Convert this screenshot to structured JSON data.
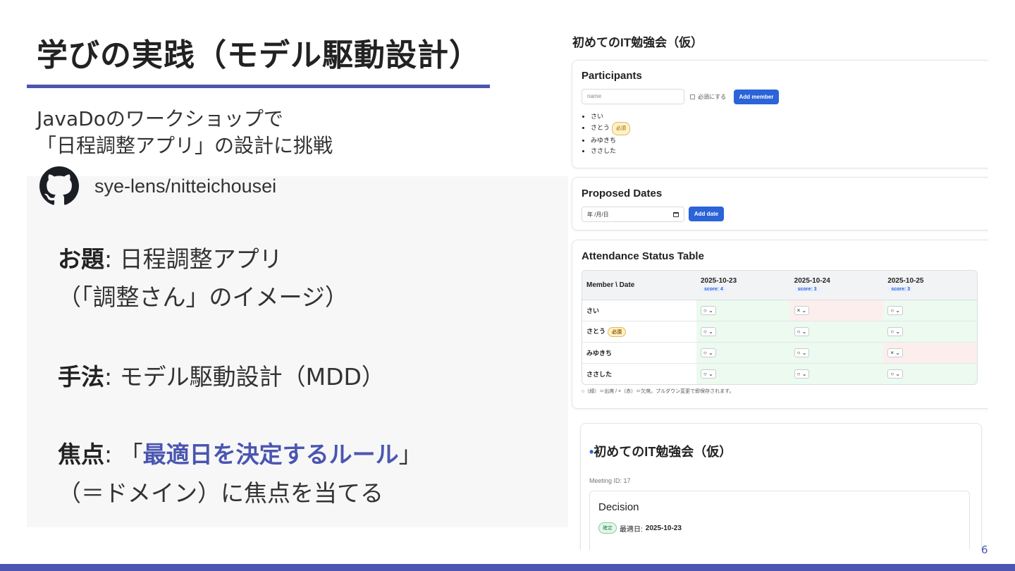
{
  "slide": {
    "title": "学びの実践（モデル駆動設計）",
    "intro_line1": "JavaDoのワークショップで",
    "intro_line2": "「日程調整アプリ」の設計に挑戦",
    "github_repo": "sye-lens/nitteichousei",
    "points": {
      "theme_label": "お題",
      "theme_value": ": 日程調整アプリ",
      "theme_note": "（「調整さん」のイメージ）",
      "method_label": "手法",
      "method_value": ": モデル駆動設計（MDD）",
      "focus_label": "焦点",
      "focus_pre": ": 「",
      "focus_highlight": "最適日を決定するルール",
      "focus_post": "」",
      "focus_note": "（＝ドメイン）に焦点を当てる"
    },
    "page_number": "6",
    "accent_color": "#4a56b0"
  },
  "app": {
    "title": "初めてのIT勉強会（仮）",
    "participants": {
      "heading": "Participants",
      "name_placeholder": "name",
      "required_checkbox_label": "必須にする",
      "add_button": "Add member",
      "members": [
        {
          "name": "さい",
          "required": false
        },
        {
          "name": "さとう",
          "required": true
        },
        {
          "name": "みゆきち",
          "required": false
        },
        {
          "name": "ささした",
          "required": false
        }
      ],
      "required_badge": "必須"
    },
    "proposed_dates": {
      "heading": "Proposed Dates",
      "date_placeholder": "年 /月/日",
      "calendar_icon": "calendar-icon",
      "add_button": "Add date"
    },
    "attendance": {
      "heading": "Attendance Status Table",
      "corner_header": "Member \\ Date",
      "dates": [
        {
          "date": "2025-10-23",
          "score": "score: 4"
        },
        {
          "date": "2025-10-24",
          "score": "score: 3"
        },
        {
          "date": "2025-10-25",
          "score": "score: 3"
        }
      ],
      "rows": [
        {
          "member": "さい",
          "required": false,
          "values": [
            "○",
            "×",
            "○"
          ]
        },
        {
          "member": "さとう",
          "required": true,
          "values": [
            "○",
            "○",
            "○"
          ]
        },
        {
          "member": "みゆきち",
          "required": false,
          "values": [
            "○",
            "○",
            "×"
          ]
        },
        {
          "member": "ささした",
          "required": false,
          "values": [
            "○",
            "○",
            "○"
          ]
        }
      ],
      "legend": "○（緑）＝出席 / ×（赤）＝欠席。プルダウン変更で即保存されます。",
      "ok_color": "#ecfaef",
      "ng_color": "#fdeeee"
    },
    "detail": {
      "title": "初めてのIT勉強会（仮）",
      "meeting_id": "Meeting ID: 17",
      "decision_heading": "Decision",
      "decision_badge": "確定",
      "best_date_label": "最適日:",
      "best_date": "2025-10-23"
    }
  }
}
